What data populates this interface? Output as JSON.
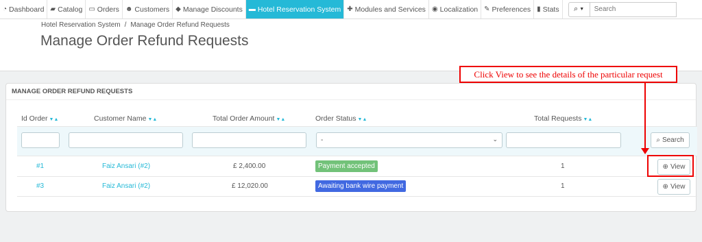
{
  "nav": {
    "items": [
      {
        "label": "Dashboard",
        "icon": "dashboard-icon",
        "glyph": "◔"
      },
      {
        "label": "Catalog",
        "icon": "catalog-icon",
        "glyph": "▰"
      },
      {
        "label": "Orders",
        "icon": "orders-icon",
        "glyph": "▭"
      },
      {
        "label": "Customers",
        "icon": "customers-icon",
        "glyph": "☻"
      },
      {
        "label": "Manage Discounts",
        "icon": "tag-icon",
        "glyph": "◆"
      },
      {
        "label": "Hotel Reservation System",
        "icon": "bed-icon",
        "glyph": "▬"
      },
      {
        "label": "Modules and Services",
        "icon": "puzzle-icon",
        "glyph": "✚"
      },
      {
        "label": "Localization",
        "icon": "globe-icon",
        "glyph": "◉"
      },
      {
        "label": "Preferences",
        "icon": "wrench-icon",
        "glyph": "✎"
      },
      {
        "label": "Stats",
        "icon": "stats-icon",
        "glyph": "▮"
      }
    ],
    "active_index": 5,
    "search_placeholder": "Search"
  },
  "header": {
    "breadcrumb_parent": "Hotel Reservation System",
    "breadcrumb_sep": "/",
    "breadcrumb_current": "Manage Order Refund Requests",
    "title": "Manage Order Refund Requests"
  },
  "panel": {
    "heading": "MANAGE ORDER REFUND REQUESTS",
    "columns": [
      "Id Order",
      "Customer Name",
      "Total Order Amount",
      "Order Status",
      "Total Requests"
    ],
    "status_filter_value": "-",
    "search_label": "Search",
    "rows": [
      {
        "id": "#1",
        "customer": "Faiz Ansari (#2)",
        "amount": "£ 2,400.00",
        "status": "Payment accepted",
        "status_color": "#72c279",
        "requests": "1",
        "action": "View"
      },
      {
        "id": "#3",
        "customer": "Faiz Ansari (#2)",
        "amount": "£ 12,020.00",
        "status": "Awaiting bank wire payment",
        "status_color": "#4169e1",
        "requests": "1",
        "action": "View"
      }
    ]
  },
  "annotation": {
    "text": "Click View to see the details of the particular request"
  }
}
